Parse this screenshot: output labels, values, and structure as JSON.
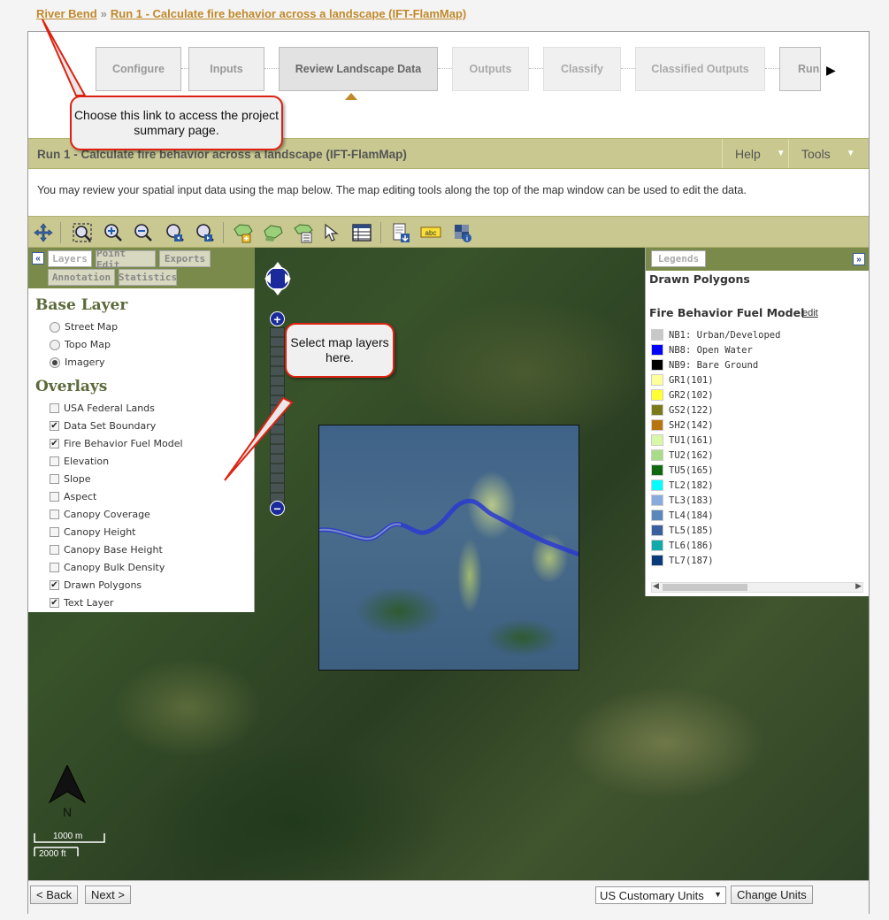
{
  "breadcrumb": {
    "project_link": "River Bend",
    "separator": "»",
    "run_link": "Run 1 - Calculate fire behavior across a landscape (IFT-FlamMap)"
  },
  "steps": [
    {
      "label": "Configure",
      "state": "done"
    },
    {
      "label": "Inputs",
      "state": "done"
    },
    {
      "label": "Review Landscape Data",
      "state": "active"
    },
    {
      "label": "Outputs",
      "state": "disabled"
    },
    {
      "label": "Classify",
      "state": "disabled"
    },
    {
      "label": "Classified Outputs",
      "state": "disabled"
    },
    {
      "label": "Run",
      "state": "done"
    }
  ],
  "titlebar": {
    "title": "Run 1 - Calculate fire behavior across a landscape (IFT-FlamMap)",
    "help": "Help",
    "tools": "Tools"
  },
  "intro": "You may review your spatial input data using the map below. The map editing tools along the top of the map window can be used to edit the data.",
  "toolbar_icons": [
    "pan-icon",
    "zoom-extent-icon",
    "zoom-in-icon",
    "zoom-out-icon",
    "zoom-previous-icon",
    "zoom-next-icon",
    "add-polygon-icon",
    "edit-polygon-icon",
    "polygon-attributes-icon",
    "select-arrow-icon",
    "table-icon",
    "export-icon",
    "text-label-icon",
    "identify-icon"
  ],
  "left_panel": {
    "tabs": [
      "Layers",
      "Point Edit",
      "Exports",
      "Annotation",
      "Statistics"
    ],
    "base_layer_title": "Base Layer",
    "base_layers": [
      {
        "label": "Street Map",
        "selected": false
      },
      {
        "label": "Topo Map",
        "selected": false
      },
      {
        "label": "Imagery",
        "selected": true
      }
    ],
    "overlays_title": "Overlays",
    "overlays": [
      {
        "label": "USA Federal Lands",
        "checked": false
      },
      {
        "label": "Data Set Boundary",
        "checked": true
      },
      {
        "label": "Fire Behavior Fuel Model",
        "checked": true
      },
      {
        "label": "Elevation",
        "checked": false
      },
      {
        "label": "Slope",
        "checked": false
      },
      {
        "label": "Aspect",
        "checked": false
      },
      {
        "label": "Canopy Coverage",
        "checked": false
      },
      {
        "label": "Canopy Height",
        "checked": false
      },
      {
        "label": "Canopy Base Height",
        "checked": false
      },
      {
        "label": "Canopy Bulk Density",
        "checked": false
      },
      {
        "label": "Drawn Polygons",
        "checked": true
      },
      {
        "label": "Text Layer",
        "checked": true
      }
    ]
  },
  "legend": {
    "tab": "Legends",
    "drawn_polygons": "Drawn Polygons",
    "fuel_model_title": "Fire Behavior Fuel Model",
    "edit": "edit",
    "items": [
      {
        "label": "NB1: Urban/Developed",
        "color": "#c8c8c8"
      },
      {
        "label": "NB8: Open Water",
        "color": "#0000ff"
      },
      {
        "label": "NB9: Bare Ground",
        "color": "#000000"
      },
      {
        "label": "GR1(101)",
        "color": "#ffff99"
      },
      {
        "label": "GR2(102)",
        "color": "#ffff33"
      },
      {
        "label": "GS2(122)",
        "color": "#7a7a1a"
      },
      {
        "label": "SH2(142)",
        "color": "#b8740e"
      },
      {
        "label": "TU1(161)",
        "color": "#d8f8a8"
      },
      {
        "label": "TU2(162)",
        "color": "#a8dc88"
      },
      {
        "label": "TU5(165)",
        "color": "#116611"
      },
      {
        "label": "TL2(182)",
        "color": "#00ffff"
      },
      {
        "label": "TL3(183)",
        "color": "#88aadd"
      },
      {
        "label": "TL4(184)",
        "color": "#5a88bb"
      },
      {
        "label": "TL5(185)",
        "color": "#3a5f9f"
      },
      {
        "label": "TL6(186)",
        "color": "#11aaaa"
      },
      {
        "label": "TL7(187)",
        "color": "#0a3a7a"
      }
    ]
  },
  "scale": {
    "metric": "1000 m",
    "imperial": "2000 ft"
  },
  "north_label": "N",
  "callouts": {
    "summary": "Choose this link to access the project summary page.",
    "layers": "Select map layers here."
  },
  "footer": {
    "back": "< Back",
    "next": "Next >",
    "units_selected": "US Customary Units",
    "change_units": "Change Units"
  }
}
